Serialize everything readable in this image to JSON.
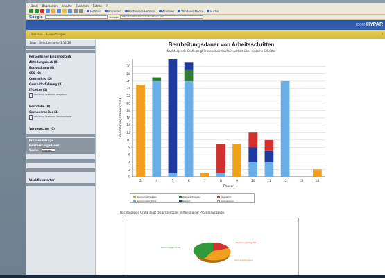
{
  "browser": {
    "menu": [
      "Datei",
      "Bearbeiten",
      "Ansicht",
      "Favoriten",
      "Extras",
      "?"
    ],
    "links": [
      "Hotmail",
      "Anpassen",
      "Kostenlose Hotmail",
      "Windows",
      "Windows Media",
      "Suche"
    ],
    "google_label": "Google",
    "address_label": "Adresse",
    "address_value": "http://localhost/phoenix/chartdemo.htm"
  },
  "site": {
    "brand": "HYPAR",
    "brand_pre": "ICOM",
    "strip_text": "Prozesse › Auswertungen",
    "strip_right": "?"
  },
  "sidebar": {
    "user": "Login: Benutzername 1.12.16",
    "items": [
      {
        "label": "Persönlicher Eingangskorb"
      },
      {
        "label": "Abteilungskorb (0)"
      },
      {
        "label": "Buchhaltung (0)"
      },
      {
        "label": "CEO (0)"
      },
      {
        "label": "Controlling (0)"
      },
      {
        "label": "Geschäftsführung (0)"
      },
      {
        "label": "IT-Leiter (1)"
      }
    ],
    "doc1": "Rechnung F1000009 Ausgaben",
    "items2": [
      {
        "label": "Poststelle (0)"
      },
      {
        "label": "Sachbearbeiter (1)"
      }
    ],
    "doc2": "Rechnung F1000009 Sachbearbeiter",
    "item3": "Vorgesetzter (0)",
    "sections": [
      "Prozessabfrage",
      "Bearbeitungsdauer"
    ],
    "search_label": "Suche",
    "search_value": "Eingabe",
    "section_bottom": "Workflowstarter"
  },
  "main": {
    "title": "Bearbeitungsdauer von Arbeitsschritten",
    "subtitle": "Nachfolgende Grafik zeigt Prozessdurchlaufzeit addiert über einzelne Schritte.",
    "second_subtitle": "Nachfolgende Grafik zeigt die prozentuale Verteilung der Prozessausgänge.",
    "pie_labels": [
      "Rechnungsfreigabe",
      "Rechnungsprüfung",
      "Zahlungsfreigabe"
    ]
  },
  "chart_data": {
    "type": "bar",
    "stacked": true,
    "categories": [
      "2",
      "4",
      "5",
      "6",
      "7",
      "8",
      "9",
      "10",
      "11",
      "12",
      "13",
      "14"
    ],
    "xlabel": "Phasen",
    "ylabel": "Bearbeitungsdauer (min)",
    "ylim": [
      0,
      32
    ],
    "yticks": [
      0,
      2,
      4,
      6,
      8,
      10,
      12,
      14,
      16,
      18,
      20,
      22,
      24,
      26,
      28,
      30
    ],
    "grid": true,
    "series": [
      {
        "name": "Rechnungsfreigabe",
        "color": "#f0a01e",
        "values": [
          25,
          0,
          0,
          0,
          1,
          0,
          9,
          0,
          0,
          0,
          0,
          2
        ]
      },
      {
        "name": "Rechnungsprüfung",
        "color": "#6aaee8",
        "values": [
          0,
          26,
          1,
          26,
          0,
          1,
          0,
          4,
          4,
          26,
          0,
          0
        ]
      },
      {
        "name": "Zahlungsfreigabe",
        "color": "#2e7d32",
        "values": [
          0,
          1,
          0,
          3,
          0,
          0,
          0,
          0,
          0,
          0,
          0,
          0
        ]
      },
      {
        "name": "Bezahlt",
        "color": "#1e3a9c",
        "values": [
          0,
          0,
          31,
          2,
          0,
          0,
          0,
          4,
          3,
          0,
          0,
          0
        ]
      },
      {
        "name": "Abgelehnt",
        "color": "#d32f2f",
        "values": [
          0,
          0,
          0,
          0,
          0,
          8,
          0,
          4,
          3,
          0,
          0,
          0
        ]
      },
      {
        "name": "Rücksendung",
        "color": "#ffffff",
        "values": [
          0,
          0,
          0,
          0,
          0,
          0,
          0,
          0,
          0,
          0,
          0,
          0
        ]
      }
    ],
    "legend": [
      "Rechnungsfreigabe",
      "Rechnungsprüfung",
      "Zahlungsfreigabe",
      "Bezahlt",
      "Abgelehnt",
      "Rücksendung"
    ],
    "legend_placement": "bottom"
  }
}
